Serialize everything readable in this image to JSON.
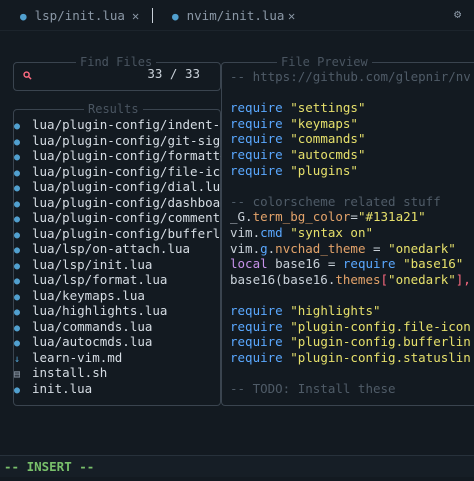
{
  "tabs": [
    {
      "label": "lsp/init.lua",
      "icon": "lua-icon",
      "close": "✕"
    },
    {
      "label": "nvim/init.lua",
      "icon": "lua-icon",
      "close": "✕"
    }
  ],
  "gear_icon": "⚙",
  "find_files": {
    "title": "Find Files",
    "count": "33 / 33"
  },
  "results": {
    "title": "Results",
    "items": [
      {
        "icon": "lua-icon",
        "label": "lua/plugin-config/indent-bl"
      },
      {
        "icon": "lua-icon",
        "label": "lua/plugin-config/git-signs"
      },
      {
        "icon": "lua-icon",
        "label": "lua/plugin-config/formatter"
      },
      {
        "icon": "lua-icon",
        "label": "lua/plugin-config/file-icon"
      },
      {
        "icon": "lua-icon",
        "label": "lua/plugin-config/dial.lua"
      },
      {
        "icon": "lua-icon",
        "label": "lua/plugin-config/dashboard"
      },
      {
        "icon": "lua-icon",
        "label": "lua/plugin-config/comments."
      },
      {
        "icon": "lua-icon",
        "label": "lua/plugin-config/bufferlin"
      },
      {
        "icon": "lua-icon",
        "label": "lua/lsp/on-attach.lua"
      },
      {
        "icon": "lua-icon",
        "label": "lua/lsp/init.lua"
      },
      {
        "icon": "lua-icon",
        "label": "lua/lsp/format.lua"
      },
      {
        "icon": "lua-icon",
        "label": "lua/keymaps.lua"
      },
      {
        "icon": "lua-icon",
        "label": "lua/highlights.lua"
      },
      {
        "icon": "lua-icon",
        "label": "lua/commands.lua"
      },
      {
        "icon": "lua-icon",
        "label": "lua/autocmds.lua"
      },
      {
        "icon": "markdown-icon",
        "label": "learn-vim.md"
      },
      {
        "icon": "shell-icon",
        "label": "install.sh"
      },
      {
        "icon": "lua-icon",
        "label": "init.lua"
      }
    ]
  },
  "preview": {
    "title": "File Preview",
    "lines": [
      [
        {
          "t": "-- https://github.com/glepnir/nvim  -",
          "c": "cmt"
        }
      ],
      [],
      [
        {
          "t": "require ",
          "c": "kw"
        },
        {
          "t": "\"settings\"",
          "c": "str"
        }
      ],
      [
        {
          "t": "require ",
          "c": "kw"
        },
        {
          "t": "\"keymaps\"",
          "c": "str"
        }
      ],
      [
        {
          "t": "require ",
          "c": "kw"
        },
        {
          "t": "\"commands\"",
          "c": "str"
        }
      ],
      [
        {
          "t": "require ",
          "c": "kw"
        },
        {
          "t": "\"autocmds\"",
          "c": "str"
        }
      ],
      [
        {
          "t": "require ",
          "c": "kw"
        },
        {
          "t": "\"plugins\"",
          "c": "str"
        }
      ],
      [],
      [
        {
          "t": "-- colorscheme related stuff",
          "c": "cmt"
        }
      ],
      [
        {
          "t": "_G.",
          "c": ""
        },
        {
          "t": "term_bg_color",
          "c": "fn"
        },
        {
          "t": "=",
          "c": ""
        },
        {
          "t": "\"#131a21\"",
          "c": "str"
        }
      ],
      [
        {
          "t": "vim.",
          "c": ""
        },
        {
          "t": "cmd ",
          "c": "kw"
        },
        {
          "t": "\"syntax on\"",
          "c": "str"
        }
      ],
      [
        {
          "t": "vim.",
          "c": ""
        },
        {
          "t": "g",
          "c": "kw"
        },
        {
          "t": ".",
          "c": ""
        },
        {
          "t": "nvchad_theme",
          "c": "fn"
        },
        {
          "t": " = ",
          "c": ""
        },
        {
          "t": "\"onedark\"",
          "c": "str"
        }
      ],
      [
        {
          "t": "local ",
          "c": "purple"
        },
        {
          "t": "base16 = ",
          "c": ""
        },
        {
          "t": "require ",
          "c": "kw"
        },
        {
          "t": "\"base16\"",
          "c": "str"
        }
      ],
      [
        {
          "t": "base16(base16.",
          "c": ""
        },
        {
          "t": "themes",
          "c": "fn"
        },
        {
          "t": "[",
          "c": "red"
        },
        {
          "t": "\"onedark\"",
          "c": "str"
        },
        {
          "t": "], ",
          "c": "red"
        },
        {
          "t": "true",
          "c": "fn"
        }
      ],
      [],
      [
        {
          "t": "require ",
          "c": "kw"
        },
        {
          "t": "\"highlights\"",
          "c": "str"
        }
      ],
      [
        {
          "t": "require ",
          "c": "kw"
        },
        {
          "t": "\"plugin-config.file-icons\"",
          "c": "str"
        }
      ],
      [
        {
          "t": "require ",
          "c": "kw"
        },
        {
          "t": "\"plugin-config.bufferline\"",
          "c": "str"
        }
      ],
      [
        {
          "t": "require ",
          "c": "kw"
        },
        {
          "t": "\"plugin-config.statusline\"",
          "c": "str"
        }
      ],
      [],
      [
        {
          "t": "-- TODO: Install these",
          "c": "cmt"
        }
      ]
    ]
  },
  "status": {
    "mode": "-- INSERT --"
  },
  "colors": {
    "background": "#131a21",
    "keyword": "#5aa8ff",
    "string": "#e6e06b",
    "comment": "#4f5b67",
    "lua_icon": "#51a0cf",
    "insert_mode": "#79c06b"
  }
}
